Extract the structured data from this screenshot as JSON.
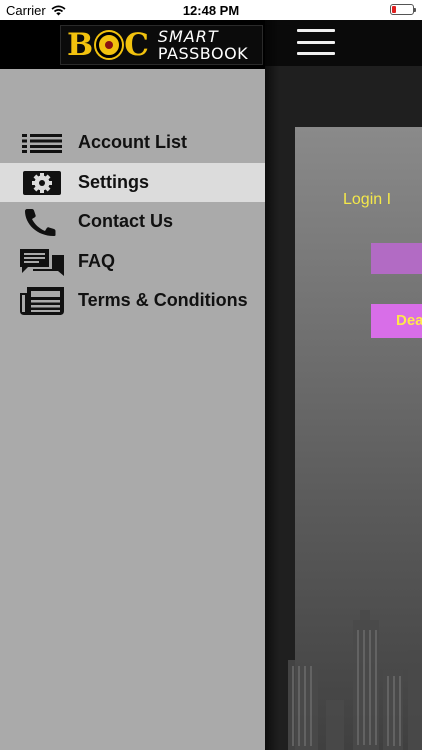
{
  "status_bar": {
    "carrier": "Carrier",
    "time": "12:48 PM"
  },
  "brand": {
    "logo_letters": "BOC",
    "logo_word1": "SMART",
    "logo_word2": "PASSBOOK",
    "accent_color": "#f2c20e"
  },
  "drawer": {
    "items": [
      {
        "label": "Account List",
        "icon": "list-icon"
      },
      {
        "label": "Settings",
        "icon": "gear-icon",
        "active": true
      },
      {
        "label": "Contact Us",
        "icon": "phone-icon"
      },
      {
        "label": "FAQ",
        "icon": "chat-bubbles-icon"
      },
      {
        "label": "Terms & Conditions",
        "icon": "document-icon"
      }
    ]
  },
  "main": {
    "login_text": "Login I",
    "button2_label": "Dea"
  }
}
